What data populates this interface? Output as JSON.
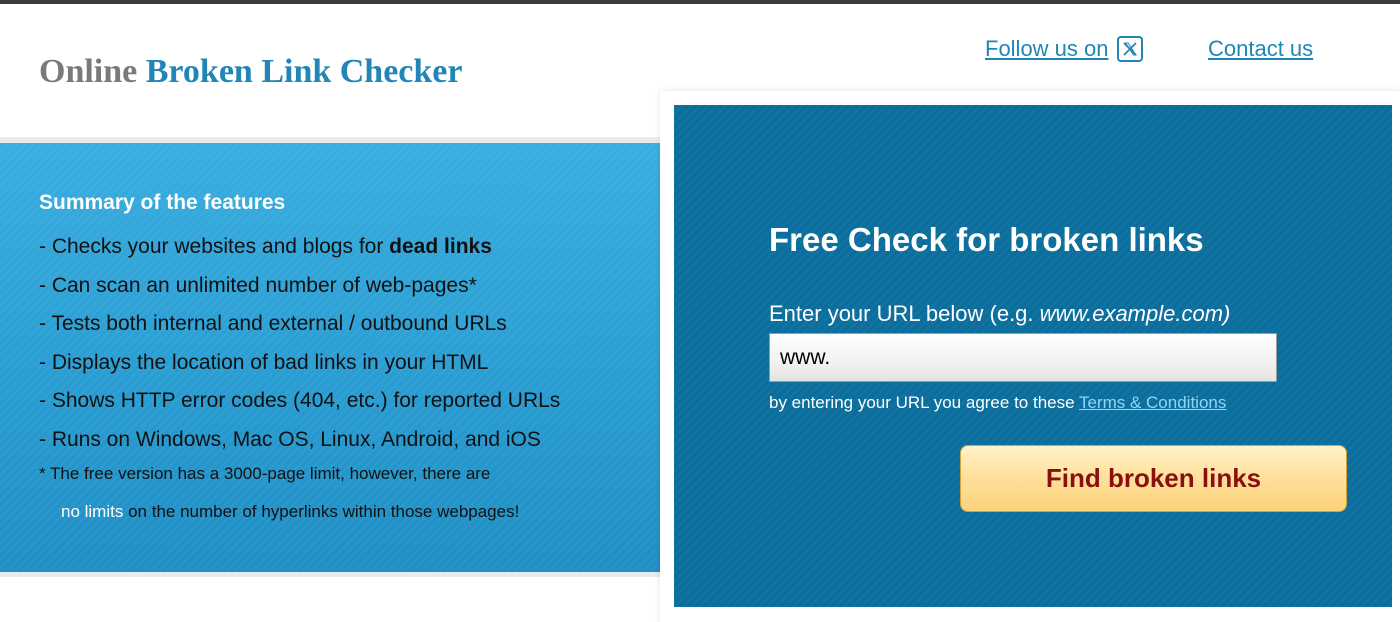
{
  "header": {
    "logo_part1": "Online",
    "logo_part2": "Broken Link Checker",
    "follow_label": "Follow us on",
    "follow_icon": "x-twitter-icon",
    "contact_label": "Contact us"
  },
  "features": {
    "title": "Summary of the features",
    "items": [
      {
        "text": "- Checks your websites and blogs for ",
        "bold": "dead links"
      },
      {
        "text": "- Can scan an unlimited number of web-pages*"
      },
      {
        "text": "- Tests both internal and external / outbound URLs"
      },
      {
        "text": "- Displays the location of bad links in your HTML"
      },
      {
        "text": "- Shows HTTP error codes (404, etc.) for reported URLs"
      },
      {
        "text": "- Runs on Windows, Mac OS, Linux, Android, and iOS"
      }
    ],
    "footnote_line1": "*  The free version has a 3000-page limit, however, there are",
    "footnote_highlight": "no limits",
    "footnote_line2_rest": " on the number of hyperlinks within those webpages!"
  },
  "check": {
    "title": "Free Check for broken links",
    "url_label": "Enter your URL below (e.g. ",
    "url_example": "www.example.com)",
    "url_value": "www.",
    "agree_text": "by entering your URL you agree to these ",
    "terms_link": "Terms & Conditions",
    "button_label": "Find broken links"
  },
  "colors": {
    "brand_blue": "#1f86b5",
    "panel_blue": "#0b6e9d",
    "feature_blue": "#2a9dd2",
    "button_gold": "#ffe09a",
    "button_text": "#8a1010"
  }
}
